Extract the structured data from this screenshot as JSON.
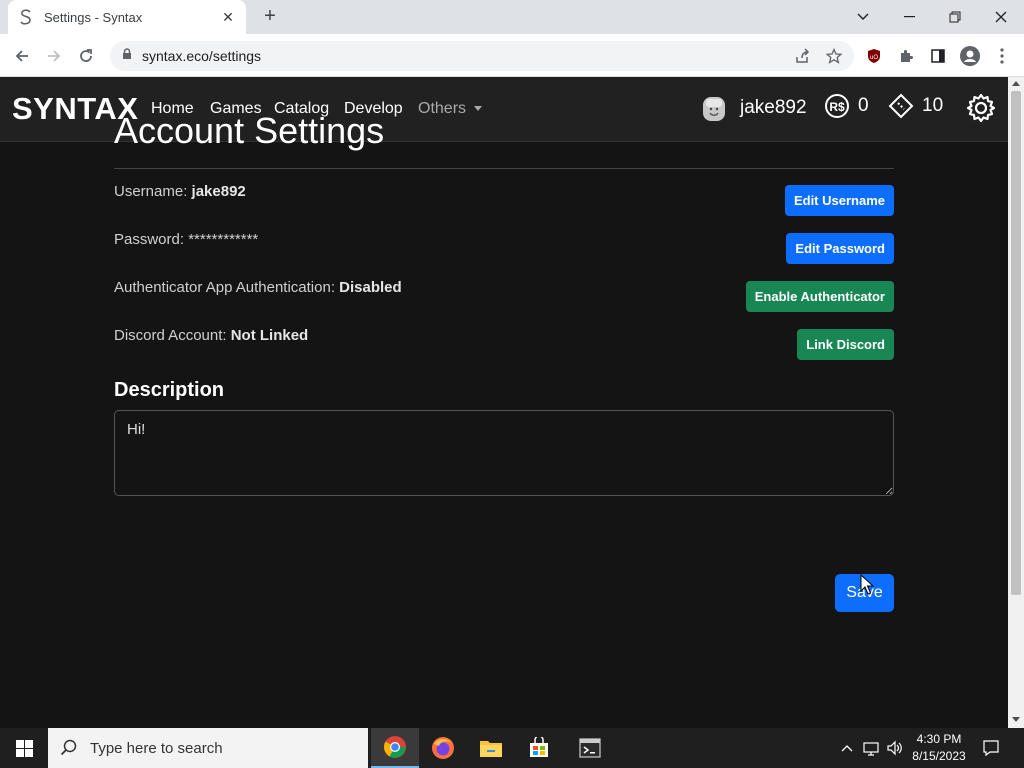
{
  "browser": {
    "tab_title": "Settings - Syntax",
    "url": "syntax.eco/settings"
  },
  "navbar": {
    "brand": "SYNTAX",
    "links": [
      "Home",
      "Games",
      "Catalog",
      "Develop",
      "Others"
    ],
    "username": "jake892",
    "robux": "0",
    "tickets": "10"
  },
  "settings": {
    "title": "Account Settings",
    "rows": [
      {
        "label": "Username: ",
        "value": "jake892",
        "button": "Edit Username"
      },
      {
        "label": "Password: ",
        "value": "************",
        "button": "Edit Password"
      },
      {
        "label": "Authenticator App Authentication: ",
        "value": "Disabled",
        "button": "Enable Authenticator"
      },
      {
        "label": "Discord Account: ",
        "value": "Not Linked",
        "button": "Link Discord"
      }
    ],
    "description_title": "Description",
    "description_value": "Hi!",
    "save_label": "Save"
  },
  "taskbar": {
    "search_placeholder": "Type here to search",
    "time": "4:30 PM",
    "date": "8/15/2023"
  },
  "colors": {
    "primary": "#0d6efd",
    "success": "#198754",
    "page_bg": "#141414",
    "navbar_bg": "#212121"
  }
}
